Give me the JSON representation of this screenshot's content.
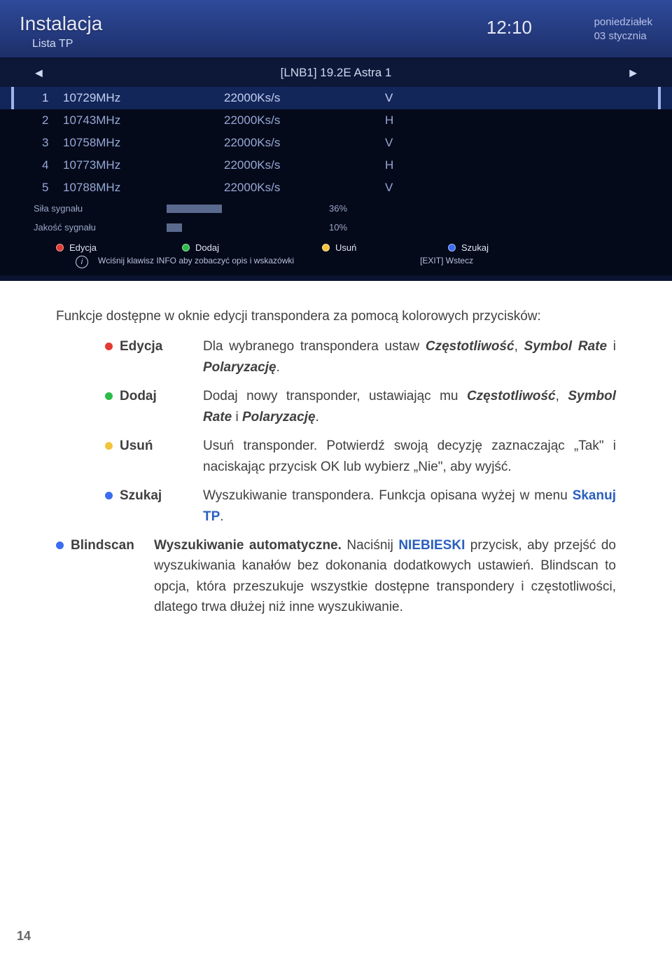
{
  "screenshot": {
    "title": "Instalacja",
    "subtitle": "Lista TP",
    "clock": "12:10",
    "date_day": "poniedziałek",
    "date_date": "03 stycznia",
    "lnb": "[LNB1] 19.2E Astra 1",
    "rows": [
      {
        "idx": "1",
        "freq": "10729MHz",
        "rate": "22000Ks/s",
        "pol": "V",
        "sel": true
      },
      {
        "idx": "2",
        "freq": "10743MHz",
        "rate": "22000Ks/s",
        "pol": "H",
        "sel": false
      },
      {
        "idx": "3",
        "freq": "10758MHz",
        "rate": "22000Ks/s",
        "pol": "V",
        "sel": false
      },
      {
        "idx": "4",
        "freq": "10773MHz",
        "rate": "22000Ks/s",
        "pol": "H",
        "sel": false
      },
      {
        "idx": "5",
        "freq": "10788MHz",
        "rate": "22000Ks/s",
        "pol": "V",
        "sel": false
      }
    ],
    "signal_strength_label": "Siła sygnału",
    "signal_strength_pct": "36%",
    "signal_strength_val": 36,
    "signal_quality_label": "Jakość sygnału",
    "signal_quality_pct": "10%",
    "signal_quality_val": 10,
    "legend": {
      "red": "Edycja",
      "green": "Dodaj",
      "yellow": "Usuń",
      "blue": "Szukaj"
    },
    "hint": "Wciśnij klawisz INFO aby zobaczyć opis i wskazówki",
    "exit": "[EXIT] Wstecz"
  },
  "article": {
    "intro": "Funkcje dostępne w oknie edycji transpondera za pomocą kolorowych przycisków:",
    "funcs": {
      "edit_label": "Edycja",
      "edit_desc_pre": "Dla wybranego transpondera ustaw ",
      "edit_t1": "Częstotliwość",
      "edit_sep1": ", ",
      "edit_t2": "Symbol Rate",
      "edit_sep2": " i ",
      "edit_t3": "Polaryzację",
      "edit_post": ".",
      "add_label": "Dodaj",
      "add_desc_pre": "Dodaj nowy transponder, ustawiając mu ",
      "add_t1": "Częstotliwość",
      "add_sep1": ", ",
      "add_t2": "Symbol Rate",
      "add_sep2": " i ",
      "add_t3": "Polaryzację",
      "add_post": ".",
      "del_label": "Usuń",
      "del_desc": "Usuń transponder. Potwierdź swoją decyzję zaznaczając „Tak\" i naciskając przycisk OK lub wybierz „Nie\", aby wyjść.",
      "search_label": "Szukaj",
      "search_desc_pre": "Wyszukiwanie transpondera. Funkcja opisana wyżej w menu ",
      "search_link": "Skanuj TP",
      "search_post": ".",
      "blind_label": "Blindscan",
      "blind_b1": "Wyszukiwanie automatyczne.",
      "blind_mid1": " Naciśnij ",
      "blind_blue": "NIEBIESKI",
      "blind_rest": " przycisk, aby przejść do wyszukiwania kanałów bez dokonania dodatkowych ustawień. Blindscan to opcja, która przeszukuje wszystkie dostępne transpondery i częstotliwości, dlatego trwa dłużej niż inne wyszukiwanie."
    }
  },
  "page_number": "14"
}
